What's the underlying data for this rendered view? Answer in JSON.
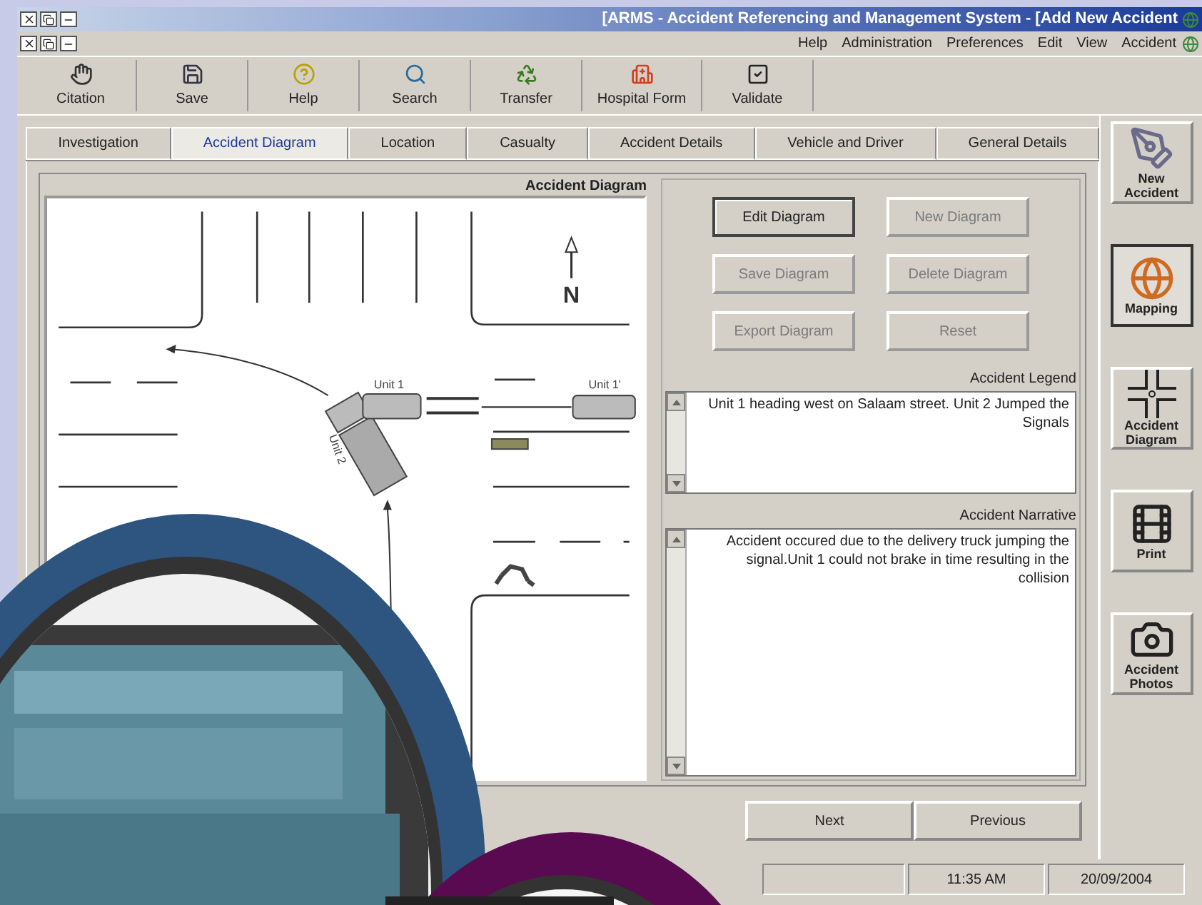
{
  "window": {
    "title": "[ARMS - Accident Referencing and Management System - [Add New Accident"
  },
  "menu": [
    "Help",
    "Administration",
    "Preferences",
    "Edit",
    "View",
    "Accident"
  ],
  "toolbar": [
    {
      "label": "Citation",
      "kind": "citation"
    },
    {
      "label": "Save",
      "kind": "save"
    },
    {
      "label": "Help",
      "kind": "help"
    },
    {
      "label": "Search",
      "kind": "search"
    },
    {
      "label": "Transfer",
      "kind": "transfer"
    },
    {
      "label": "Hospital Form",
      "kind": "hospital"
    },
    {
      "label": "Validate",
      "kind": "validate"
    }
  ],
  "tabs": [
    {
      "label": "Investigation",
      "selected": false
    },
    {
      "label": "Accident Diagram",
      "selected": true
    },
    {
      "label": "Location",
      "selected": false
    },
    {
      "label": "Casualty",
      "selected": false
    },
    {
      "label": "Accident Details",
      "selected": false
    },
    {
      "label": "Vehicle and Driver",
      "selected": false
    },
    {
      "label": "General Details",
      "selected": false
    }
  ],
  "diagram": {
    "title": "Accident Diagram",
    "north": "N",
    "unit_labels": [
      "Unit 1",
      "Unit 1'",
      "Unit 2"
    ]
  },
  "diagram_buttons": [
    {
      "label": "Edit Diagram",
      "disabled": false
    },
    {
      "label": "New Diagram",
      "disabled": true
    },
    {
      "label": "Save Diagram",
      "disabled": true
    },
    {
      "label": "Delete Diagram",
      "disabled": true
    },
    {
      "label": "Export Diagram",
      "disabled": true
    },
    {
      "label": "Reset",
      "disabled": true
    }
  ],
  "legend": {
    "label": "Accident Legend",
    "value": "Unit 1 heading west on Salaam street. Unit 2 Jumped the Signals"
  },
  "narrative": {
    "label": "Accident Narrative",
    "value": "Accident occured due to the delivery truck jumping the signal.Unit 1 could not brake in time resulting in the collision"
  },
  "nav_buttons": [
    "Next",
    "Previous"
  ],
  "side_buttons": [
    {
      "label": "New Accident",
      "kind": "new",
      "selected": false
    },
    {
      "label": "Mapping",
      "kind": "mapping",
      "selected": true
    },
    {
      "label": "Accident Diagram",
      "kind": "diagram",
      "selected": false
    },
    {
      "label": "Print",
      "kind": "print",
      "selected": false
    },
    {
      "label": "Accident Photos",
      "kind": "photos",
      "selected": false
    }
  ],
  "status_bar": {
    "time": "11:35 AM",
    "date": "20/09/2004"
  }
}
